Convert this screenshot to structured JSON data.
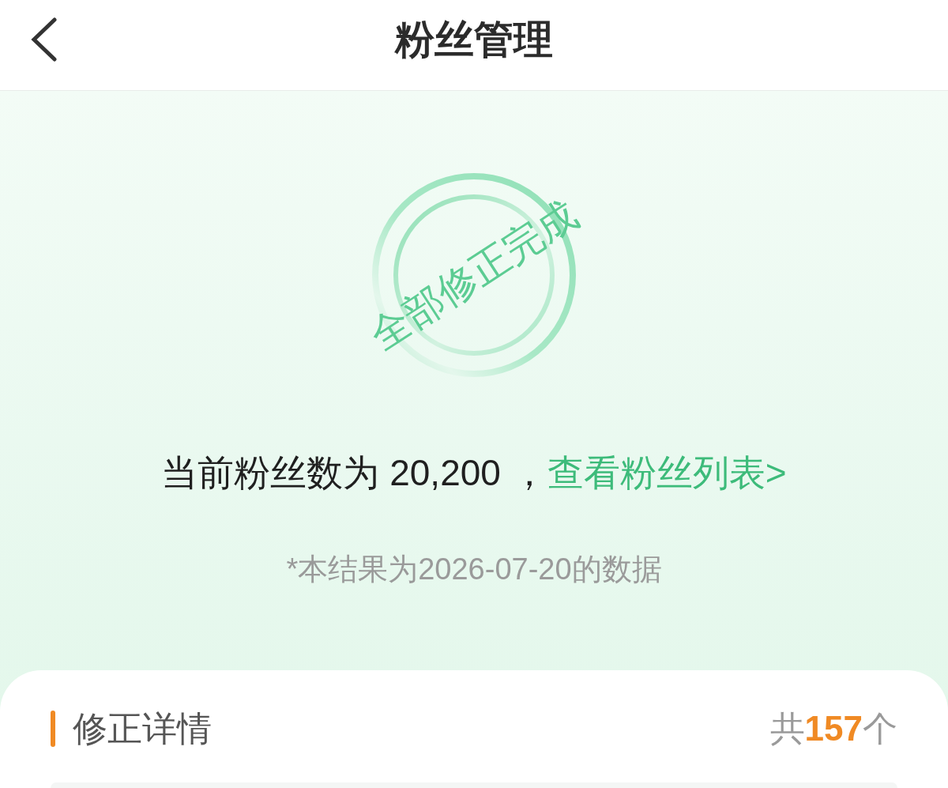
{
  "header": {
    "title": "粉丝管理"
  },
  "result": {
    "stamp": "全部修正完成",
    "summary": {
      "text": "当前粉丝数为 20,200 ，",
      "link": "查看粉丝列表>"
    },
    "note": "*本结果为2026-07-20的数据"
  },
  "details": {
    "title": "修正详情",
    "total": "共**157**个"
  }
}
